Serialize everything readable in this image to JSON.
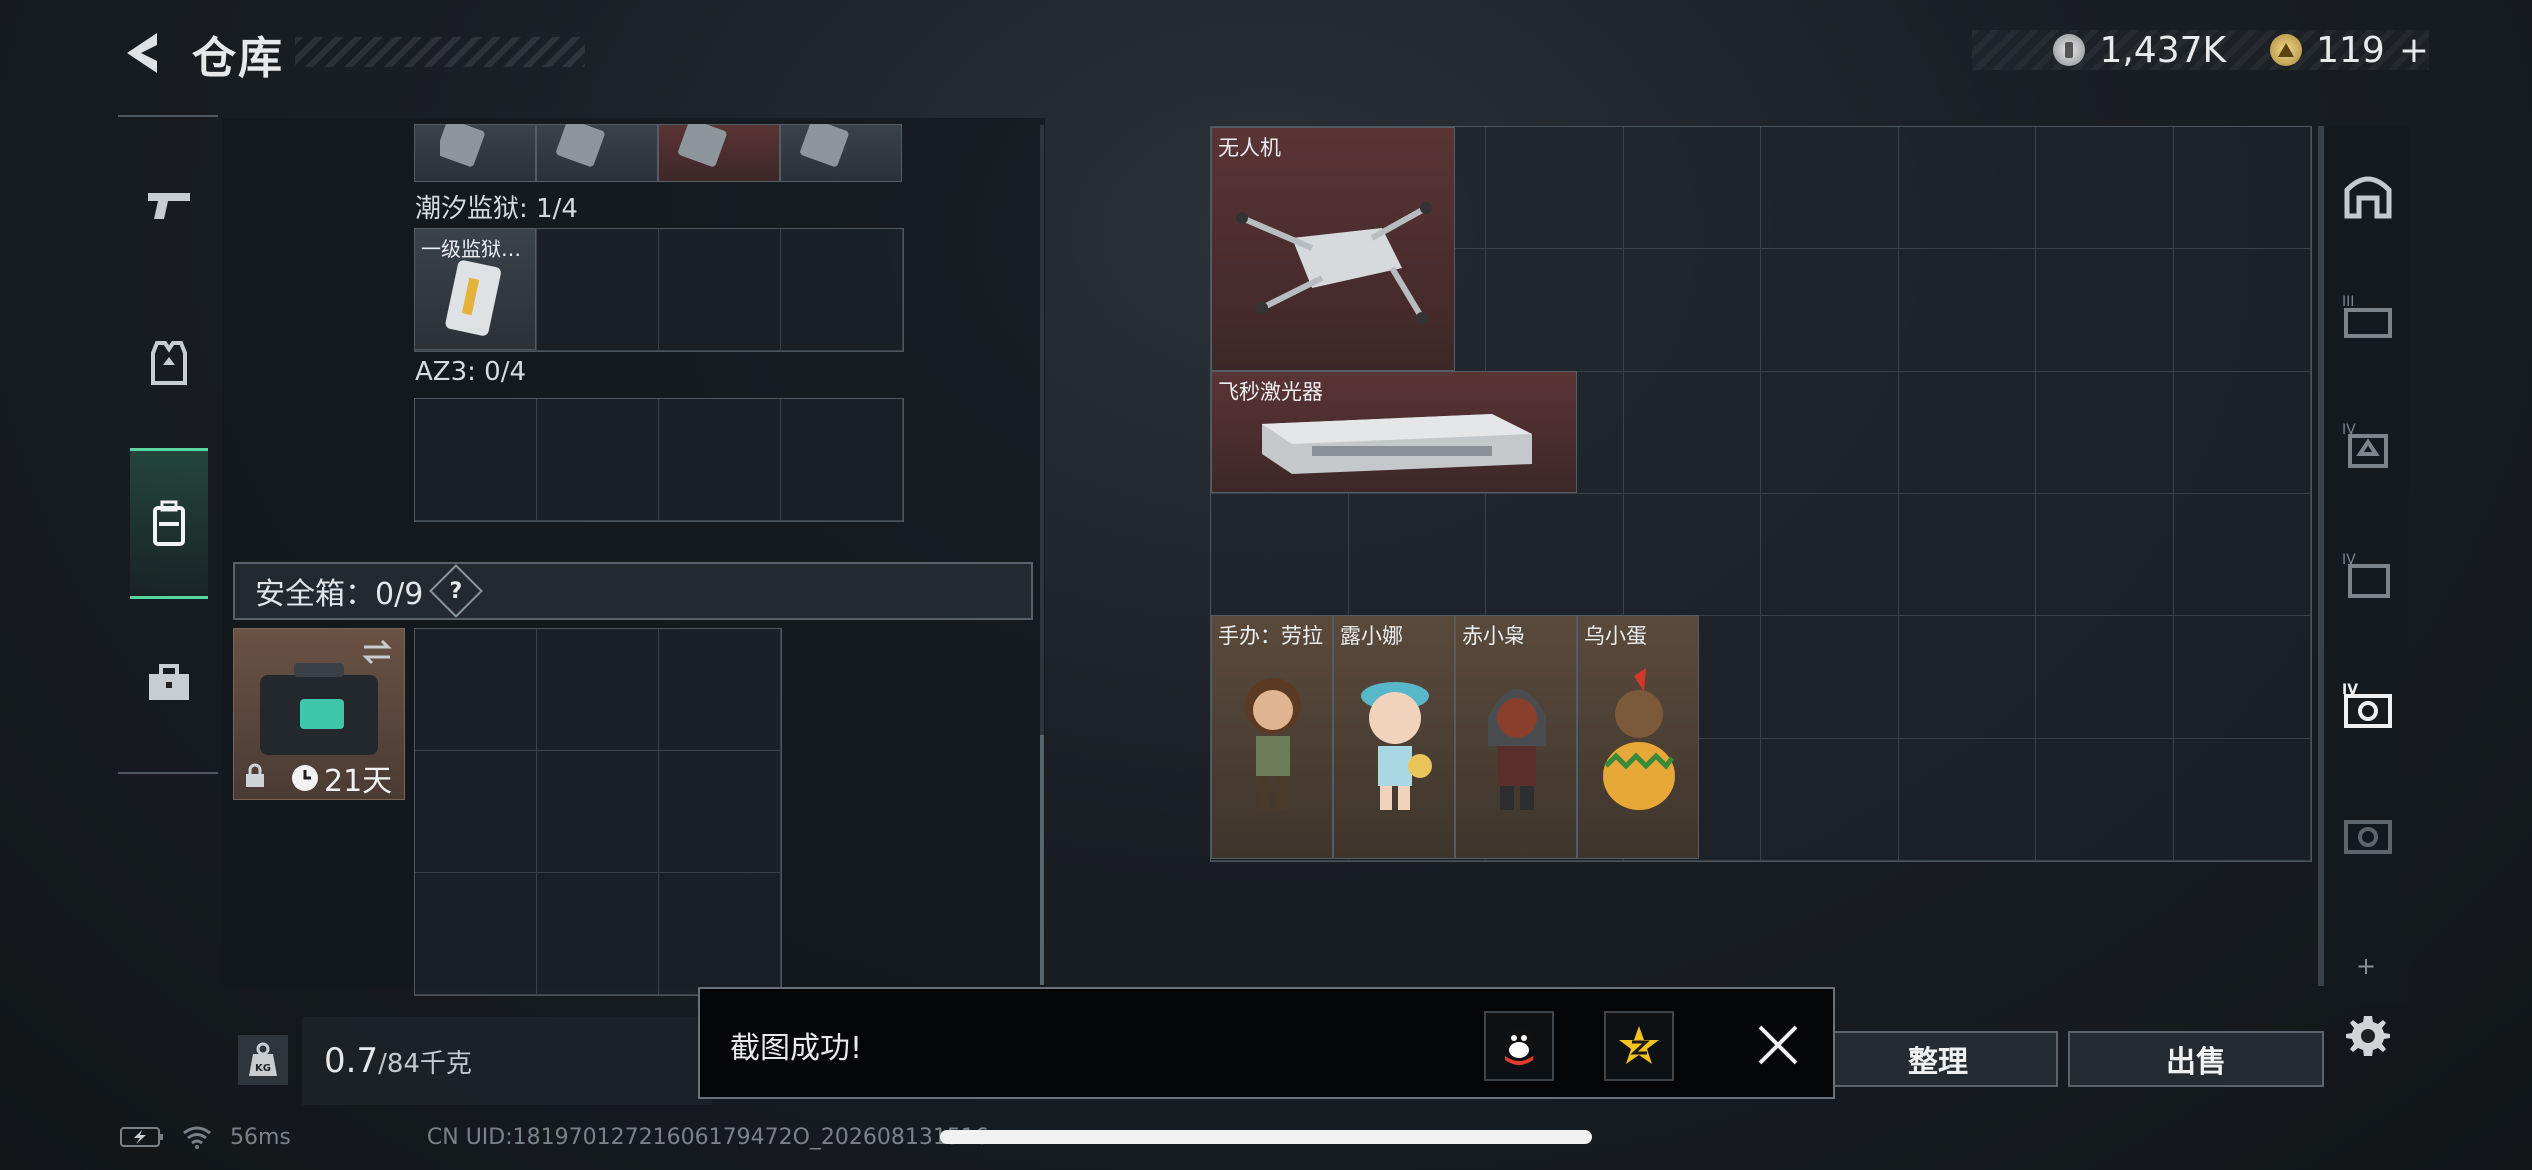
{
  "header": {
    "title": "仓库",
    "currency": [
      {
        "icon": "silver-coin-icon",
        "value": "1,437K"
      },
      {
        "icon": "gold-coin-icon",
        "value": "119"
      }
    ],
    "add_label": "+"
  },
  "categories": [
    {
      "name": "weapons",
      "icon": "pistol-icon"
    },
    {
      "name": "equipment",
      "icon": "vest-icon"
    },
    {
      "name": "backpack",
      "icon": "backpack-icon",
      "selected": true
    },
    {
      "name": "supplies",
      "icon": "toolbox-icon"
    }
  ],
  "left": {
    "sections": [
      {
        "label": "潮汐监狱: 1/4",
        "item_label": "一级监狱…"
      },
      {
        "label": "AZ3: 0/4"
      }
    ],
    "safe_label": "安全箱：0/9",
    "safe_help": "?",
    "safe_days": "21天",
    "weight_value": "0.7",
    "weight_max": "/84千克",
    "weight_icon_text": "KG"
  },
  "right": {
    "items": [
      {
        "label": "无人机"
      },
      {
        "label": "飞秒激光器"
      },
      {
        "label": "手办：劳拉"
      },
      {
        "label": "露小娜"
      },
      {
        "label": "赤小枭"
      },
      {
        "label": "乌小蛋"
      }
    ],
    "rail": [
      "map-icon",
      "armor-iii-icon",
      "armor-iv-icon",
      "case-iv-icon",
      "camera-iv-icon",
      "camera-icon"
    ],
    "rail_small": "+"
  },
  "buttons": {
    "sort": "整理",
    "sell": "出售"
  },
  "toast": {
    "message": "截图成功!"
  },
  "status": {
    "ping": "56ms",
    "uid": "CN UID:18197012721606179472O_202608131516"
  }
}
